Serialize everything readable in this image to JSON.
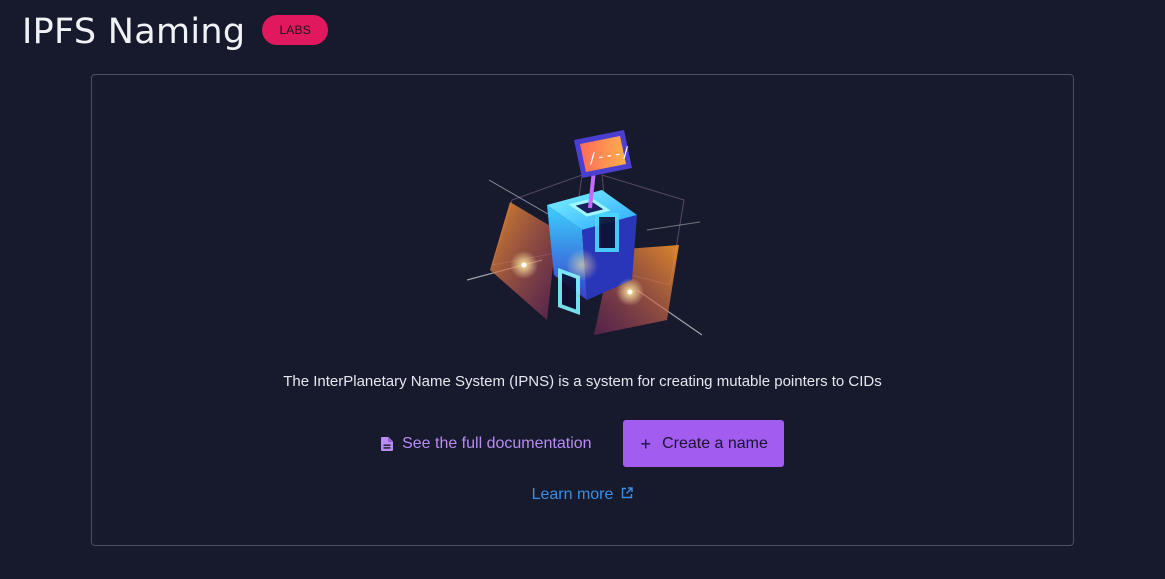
{
  "header": {
    "title": "IPFS Naming",
    "badge": "LABS"
  },
  "card": {
    "description": "The InterPlanetary Name System (IPNS) is a system for creating mutable pointers to CIDs",
    "doc_link_label": "See the full documentation",
    "create_button_label": "Create a name",
    "learn_more_label": "Learn more"
  },
  "icons": {
    "doc_icon": "document-icon",
    "plus_icon": "plus-icon",
    "external_icon": "external-link-icon"
  },
  "colors": {
    "background": "#161a2c",
    "badge": "#e0195f",
    "accent": "#a35cf0",
    "link": "#3a8ee8"
  }
}
